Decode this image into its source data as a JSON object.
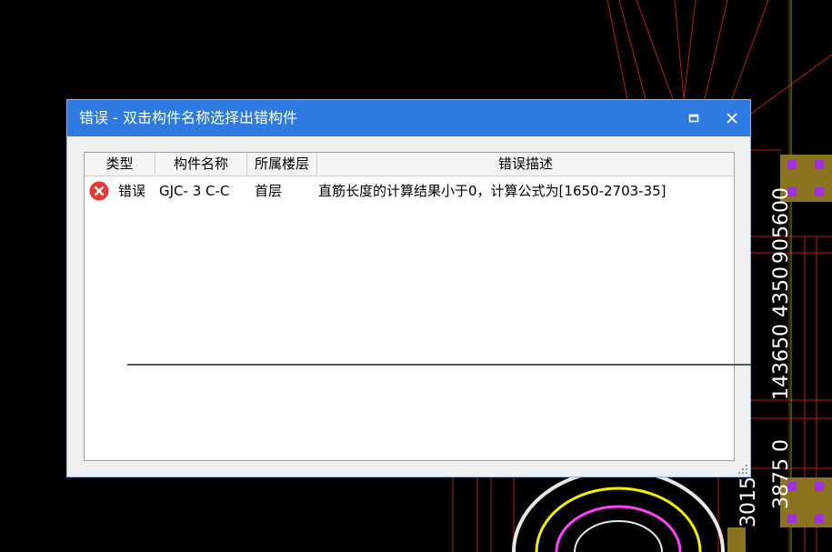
{
  "dialog": {
    "title": "错误 - 双击构件名称选择出错构件",
    "maximize_icon": "maximize-icon",
    "close_icon": "close-icon"
  },
  "table": {
    "columns": [
      "类型",
      "构件名称",
      "所属楼层",
      "错误描述"
    ],
    "rows": [
      {
        "icon": "error-icon",
        "type": "错误",
        "name": "GJC- 3 C-C",
        "floor": "首层",
        "description": "直筋长度的计算结果小于0，计算公式为[1650-2703-35]"
      }
    ]
  },
  "background": {
    "dim_labels": [
      "905600",
      "143650 4350",
      "3875 0",
      "3015"
    ],
    "colors": {
      "lines": "#d42020",
      "green": "#22c022",
      "yellow": "#f2f200",
      "purple": "#a030e0",
      "magenta": "#ff40ff"
    }
  }
}
